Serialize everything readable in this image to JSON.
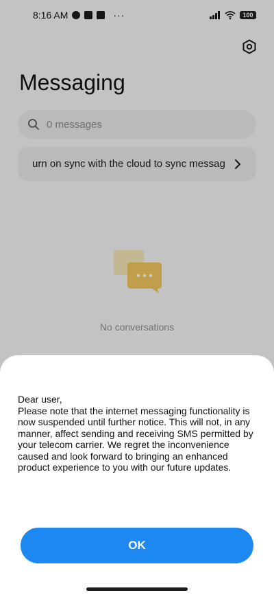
{
  "status_bar": {
    "time": "8:16 AM",
    "more": "···",
    "battery": "100",
    "icons": [
      "telegram-icon",
      "app-icon",
      "upload-icon",
      "signal-icon",
      "wifi-icon",
      "battery-icon"
    ]
  },
  "header": {
    "title": "Messaging",
    "settings_icon": "settings-icon"
  },
  "search": {
    "placeholder": "0 messages"
  },
  "sync_banner": {
    "text": "urn on sync with the cloud to sync messag"
  },
  "empty_state": {
    "text": "No conversations",
    "icon": "chat-bubbles-icon"
  },
  "dialog": {
    "lines": [
      "Dear user,",
      "Please note that the internet messaging functionality is now suspended until further notice. This will not, in any manner, affect sending and receiving SMS permitted by your telecom carrier. We regret the inconvenience caused and look forward to bringing an enhanced product experience to you with our future updates."
    ],
    "ok_label": "OK"
  },
  "colors": {
    "accent": "#1e88f2",
    "empty_icon": "#f0c660"
  }
}
